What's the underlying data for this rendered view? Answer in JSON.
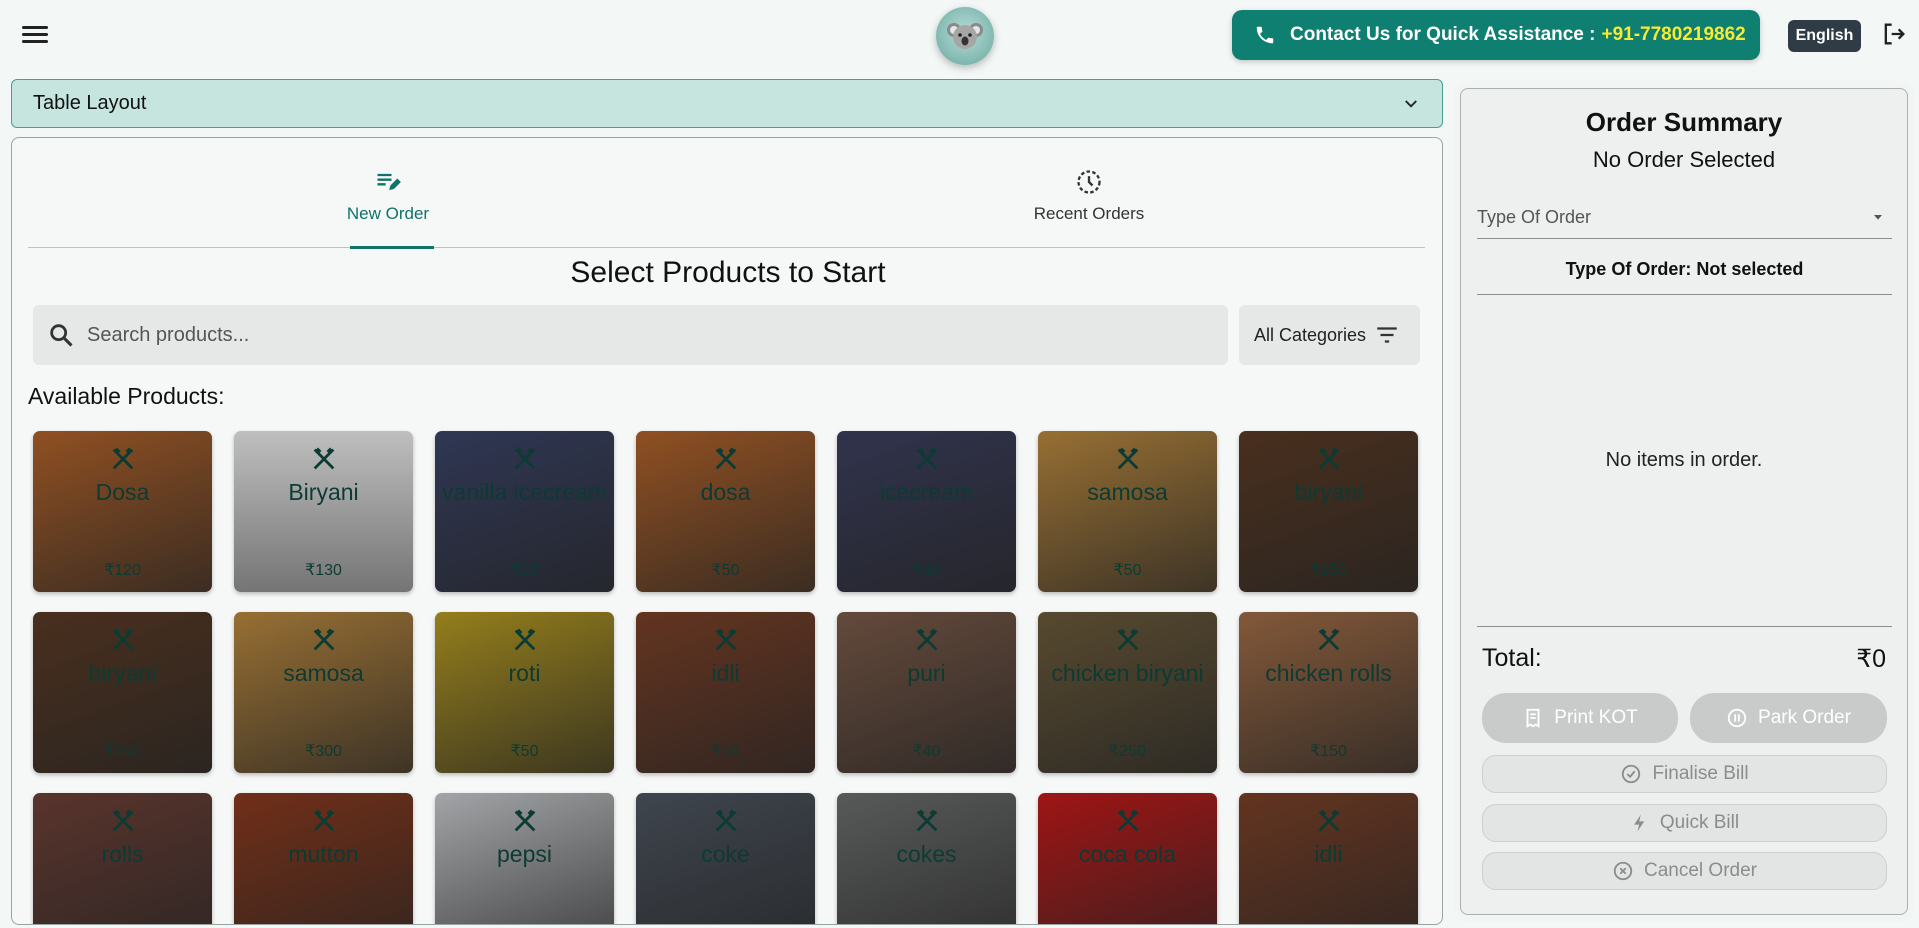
{
  "header": {
    "contact_label": "Contact Us for Quick Assistance :",
    "contact_phone": "+91-7780219862",
    "language": "English"
  },
  "table_layout": {
    "label": "Table Layout"
  },
  "tabs": [
    {
      "label": "New Order",
      "active": true
    },
    {
      "label": "Recent Orders",
      "active": false
    }
  ],
  "main": {
    "title": "Select Products to Start",
    "search_placeholder": "Search products...",
    "category_filter": "All Categories",
    "available_label": "Available Products:"
  },
  "products": [
    {
      "name": "Dosa",
      "price": "₹120",
      "color": "#b0622a"
    },
    {
      "name": "Biryani",
      "price": "₹130",
      "color": "#bdbdbd"
    },
    {
      "name": "vanilla icecream",
      "price": "₹25",
      "color": "#3a4366"
    },
    {
      "name": "dosa",
      "price": "₹50",
      "color": "#b0622a"
    },
    {
      "name": "icecream",
      "price": "₹40",
      "color": "#3c3f5e"
    },
    {
      "name": "samosa",
      "price": "₹50",
      "color": "#b9883f"
    },
    {
      "name": "biryani",
      "price": "₹150",
      "color": "#5a3a25"
    },
    {
      "name": "biryani",
      "price": "₹150",
      "color": "#5a3a25"
    },
    {
      "name": "samosa",
      "price": "₹300",
      "color": "#b9883f"
    },
    {
      "name": "roti",
      "price": "₹50",
      "color": "#b59a22"
    },
    {
      "name": "idli",
      "price": "₹50",
      "color": "#7a4028"
    },
    {
      "name": "puri",
      "price": "₹40",
      "color": "#7a5a48"
    },
    {
      "name": "chicken biryani",
      "price": "₹250",
      "color": "#6b5a3a"
    },
    {
      "name": "chicken rolls",
      "price": "₹150",
      "color": "#a06c46"
    },
    {
      "name": "rolls",
      "price": "",
      "color": "#6d4036"
    },
    {
      "name": "mutton",
      "price": "",
      "color": "#8a3a1e"
    },
    {
      "name": "pepsi",
      "price": "",
      "color": "#c6c9cc"
    },
    {
      "name": "coke",
      "price": "",
      "color": "#4d5560"
    },
    {
      "name": "cokes",
      "price": "",
      "color": "#6b6e6c"
    },
    {
      "name": "coca cola",
      "price": "",
      "color": "#c21a1a"
    },
    {
      "name": "idli",
      "price": "",
      "color": "#7a4028"
    }
  ],
  "summary": {
    "title": "Order Summary",
    "subtitle": "No Order Selected",
    "type_placeholder": "Type Of Order",
    "type_line": "Type Of Order: Not selected",
    "empty_text": "No items in order.",
    "total_label": "Total:",
    "total_value": "₹0",
    "buttons": {
      "print_kot": "Print KOT",
      "park_order": "Park Order",
      "finalise_bill": "Finalise Bill",
      "quick_bill": "Quick Bill",
      "cancel_order": "Cancel Order"
    }
  }
}
